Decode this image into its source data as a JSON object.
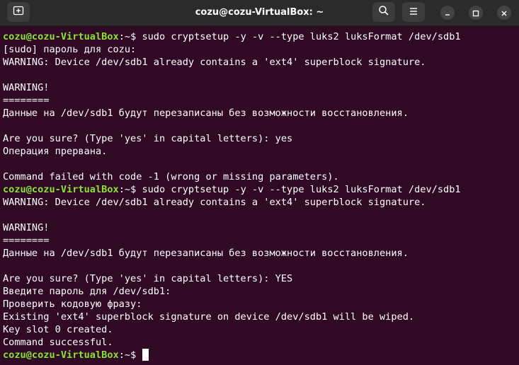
{
  "window": {
    "title": "cozu@cozu-VirtualBox: ~"
  },
  "titlebar": {
    "new_tab_icon": "new-tab-icon",
    "search_icon": "search-icon",
    "menu_icon": "hamburger-menu-icon",
    "minimize_icon": "minimize-icon",
    "maximize_icon": "maximize-icon",
    "close_icon": "close-icon"
  },
  "colors": {
    "terminal_bg": "#300a24",
    "prompt_user": "#8ae234",
    "text": "#ffffff",
    "titlebar_bg": "#2b2b2b"
  },
  "terminal": {
    "prompt": {
      "user_host": "cozu@cozu-VirtualBox",
      "path": ":~",
      "symbol": "$ "
    },
    "lines": [
      {
        "type": "prompt",
        "command": "sudo cryptsetup -y -v --type luks2 luksFormat /dev/sdb1"
      },
      {
        "type": "output",
        "text": "[sudo] пароль для cozu:"
      },
      {
        "type": "output",
        "text": "WARNING: Device /dev/sdb1 already contains a 'ext4' superblock signature."
      },
      {
        "type": "output",
        "text": ""
      },
      {
        "type": "output",
        "text": "WARNING!"
      },
      {
        "type": "output",
        "text": "========"
      },
      {
        "type": "output",
        "text": "Данные на /dev/sdb1 будут перезаписаны без возможности восстановления."
      },
      {
        "type": "output",
        "text": ""
      },
      {
        "type": "output",
        "text": "Are you sure? (Type 'yes' in capital letters): yes"
      },
      {
        "type": "output",
        "text": "Операция прервана."
      },
      {
        "type": "output",
        "text": ""
      },
      {
        "type": "output",
        "text": "Command failed with code -1 (wrong or missing parameters)."
      },
      {
        "type": "prompt",
        "command": "sudo cryptsetup -y -v --type luks2 luksFormat /dev/sdb1"
      },
      {
        "type": "output",
        "text": "WARNING: Device /dev/sdb1 already contains a 'ext4' superblock signature."
      },
      {
        "type": "output",
        "text": ""
      },
      {
        "type": "output",
        "text": "WARNING!"
      },
      {
        "type": "output",
        "text": "========"
      },
      {
        "type": "output",
        "text": "Данные на /dev/sdb1 будут перезаписаны без возможности восстановления."
      },
      {
        "type": "output",
        "text": ""
      },
      {
        "type": "output",
        "text": "Are you sure? (Type 'yes' in capital letters): YES"
      },
      {
        "type": "output",
        "text": "Введите пароль для /dev/sdb1:"
      },
      {
        "type": "output",
        "text": "Проверить кодовую фразу:"
      },
      {
        "type": "output",
        "text": "Existing 'ext4' superblock signature on device /dev/sdb1 will be wiped."
      },
      {
        "type": "output",
        "text": "Key slot 0 created."
      },
      {
        "type": "output",
        "text": "Command successful."
      },
      {
        "type": "prompt",
        "command": "",
        "cursor": true
      }
    ]
  }
}
